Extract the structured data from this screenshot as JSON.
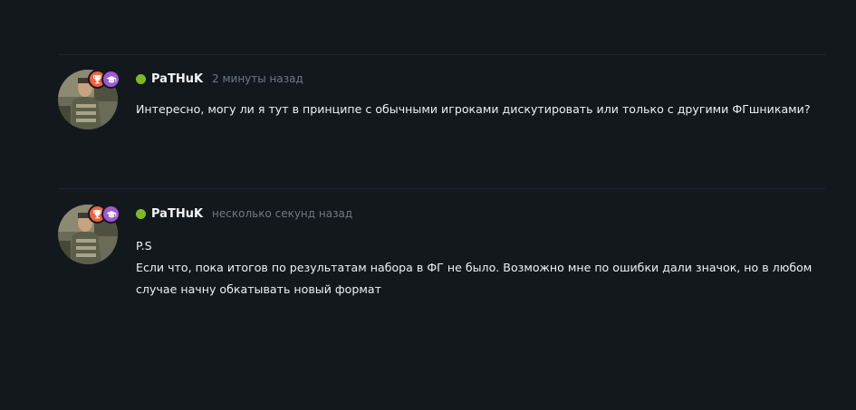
{
  "comments": [
    {
      "user": "PaTHuK",
      "time": "2 минуты назад",
      "lines": [
        "Интересно, могу ли я тут в принципе с обычными игроками дискутировать или только с другими ФГшниками?"
      ],
      "online_color": "#7dbb24",
      "badges": [
        "trophy-icon",
        "graduation-cap-icon"
      ]
    },
    {
      "user": "PaTHuK",
      "time": "несколько секунд назад",
      "lines": [
        "P.S",
        "Если что, пока итогов по результатам набора в ФГ не было. Возможно мне по ошибки дали значок, но в любом",
        "случае начну обкатывать новый формат"
      ],
      "online_color": "#7dbb24",
      "badges": [
        "trophy-icon",
        "graduation-cap-icon"
      ]
    }
  ],
  "colors": {
    "background": "#13181c",
    "trophy_badge": "#f2603c",
    "graduation_badge": "#9d5ad4",
    "time": "#6e7a82"
  }
}
